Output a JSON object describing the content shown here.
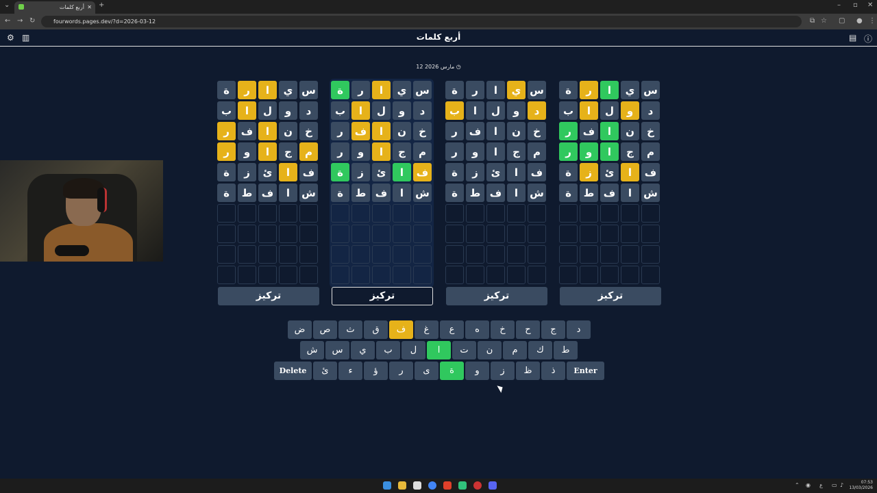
{
  "browser": {
    "tab_title": "أربع كلمات",
    "url": "fourwords.pages.dev/?d=2026-03-12"
  },
  "app": {
    "title": "أربع كلمات",
    "date": "12 مارس 2026"
  },
  "boards": [
    {
      "focus_label": "تركيز",
      "focused": false,
      "rows": [
        [
          [
            "س",
            "n"
          ],
          [
            "ي",
            "n"
          ],
          [
            "ا",
            "g"
          ],
          [
            "ر",
            "y"
          ],
          [
            "ة",
            "n"
          ]
        ],
        [
          [
            "د",
            "n"
          ],
          [
            "و",
            "y"
          ],
          [
            "ل",
            "n"
          ],
          [
            "ا",
            "y"
          ],
          [
            "ب",
            "n"
          ]
        ],
        [
          [
            "خ",
            "n"
          ],
          [
            "ن",
            "n"
          ],
          [
            "ا",
            "g"
          ],
          [
            "ف",
            "n"
          ],
          [
            "ر",
            "g"
          ]
        ],
        [
          [
            "م",
            "n"
          ],
          [
            "ج",
            "n"
          ],
          [
            "ا",
            "g"
          ],
          [
            "و",
            "g"
          ],
          [
            "ر",
            "g"
          ]
        ],
        [
          [
            "ف",
            "n"
          ],
          [
            "ا",
            "y"
          ],
          [
            "ئ",
            "n"
          ],
          [
            "ز",
            "y"
          ],
          [
            "ة",
            "n"
          ]
        ],
        [
          [
            "ش",
            "n"
          ],
          [
            "ا",
            "n"
          ],
          [
            "ف",
            "n"
          ],
          [
            "ط",
            "n"
          ],
          [
            "ة",
            "n"
          ]
        ]
      ]
    },
    {
      "focus_label": "تركيز",
      "focused": false,
      "rows": [
        [
          [
            "س",
            "n"
          ],
          [
            "ي",
            "y"
          ],
          [
            "ا",
            "n"
          ],
          [
            "ر",
            "n"
          ],
          [
            "ة",
            "n"
          ]
        ],
        [
          [
            "د",
            "y"
          ],
          [
            "و",
            "n"
          ],
          [
            "ل",
            "n"
          ],
          [
            "ا",
            "n"
          ],
          [
            "ب",
            "y"
          ]
        ],
        [
          [
            "خ",
            "n"
          ],
          [
            "ن",
            "n"
          ],
          [
            "ا",
            "n"
          ],
          [
            "ف",
            "n"
          ],
          [
            "ر",
            "n"
          ]
        ],
        [
          [
            "م",
            "n"
          ],
          [
            "ج",
            "n"
          ],
          [
            "ا",
            "n"
          ],
          [
            "و",
            "n"
          ],
          [
            "ر",
            "n"
          ]
        ],
        [
          [
            "ف",
            "n"
          ],
          [
            "ا",
            "n"
          ],
          [
            "ئ",
            "n"
          ],
          [
            "ز",
            "n"
          ],
          [
            "ة",
            "n"
          ]
        ],
        [
          [
            "ش",
            "n"
          ],
          [
            "ا",
            "n"
          ],
          [
            "ف",
            "n"
          ],
          [
            "ط",
            "n"
          ],
          [
            "ة",
            "n"
          ]
        ]
      ]
    },
    {
      "focus_label": "تركيز",
      "focused": true,
      "rows": [
        [
          [
            "س",
            "n"
          ],
          [
            "ي",
            "n"
          ],
          [
            "ا",
            "y"
          ],
          [
            "ر",
            "n"
          ],
          [
            "ة",
            "g"
          ]
        ],
        [
          [
            "د",
            "n"
          ],
          [
            "و",
            "n"
          ],
          [
            "ل",
            "n"
          ],
          [
            "ا",
            "y"
          ],
          [
            "ب",
            "n"
          ]
        ],
        [
          [
            "خ",
            "n"
          ],
          [
            "ن",
            "n"
          ],
          [
            "ا",
            "y"
          ],
          [
            "ف",
            "y"
          ],
          [
            "ر",
            "n"
          ]
        ],
        [
          [
            "م",
            "n"
          ],
          [
            "ج",
            "n"
          ],
          [
            "ا",
            "y"
          ],
          [
            "و",
            "n"
          ],
          [
            "ر",
            "n"
          ]
        ],
        [
          [
            "ف",
            "y"
          ],
          [
            "ا",
            "g"
          ],
          [
            "ئ",
            "n"
          ],
          [
            "ز",
            "n"
          ],
          [
            "ة",
            "g"
          ]
        ],
        [
          [
            "ش",
            "n"
          ],
          [
            "ا",
            "n"
          ],
          [
            "ف",
            "n"
          ],
          [
            "ط",
            "n"
          ],
          [
            "ة",
            "n"
          ]
        ]
      ]
    },
    {
      "focus_label": "تركيز",
      "focused": false,
      "rows": [
        [
          [
            "س",
            "n"
          ],
          [
            "ي",
            "n"
          ],
          [
            "ا",
            "y"
          ],
          [
            "ر",
            "y"
          ],
          [
            "ة",
            "n"
          ]
        ],
        [
          [
            "د",
            "n"
          ],
          [
            "و",
            "n"
          ],
          [
            "ل",
            "n"
          ],
          [
            "ا",
            "y"
          ],
          [
            "ب",
            "n"
          ]
        ],
        [
          [
            "خ",
            "n"
          ],
          [
            "ن",
            "n"
          ],
          [
            "ا",
            "y"
          ],
          [
            "ف",
            "n"
          ],
          [
            "ر",
            "y"
          ]
        ],
        [
          [
            "م",
            "y"
          ],
          [
            "ج",
            "n"
          ],
          [
            "ا",
            "y"
          ],
          [
            "و",
            "n"
          ],
          [
            "ر",
            "y"
          ]
        ],
        [
          [
            "ف",
            "n"
          ],
          [
            "ا",
            "y"
          ],
          [
            "ئ",
            "n"
          ],
          [
            "ز",
            "n"
          ],
          [
            "ة",
            "n"
          ]
        ],
        [
          [
            "ش",
            "n"
          ],
          [
            "ا",
            "n"
          ],
          [
            "ف",
            "n"
          ],
          [
            "ط",
            "n"
          ],
          [
            "ة",
            "n"
          ]
        ]
      ]
    }
  ],
  "keyboard": {
    "row1": [
      [
        "د",
        "n"
      ],
      [
        "ج",
        "n"
      ],
      [
        "ح",
        "n"
      ],
      [
        "خ",
        "n"
      ],
      [
        "ه",
        "n"
      ],
      [
        "ع",
        "n"
      ],
      [
        "غ",
        "n"
      ],
      [
        "ف",
        "y"
      ],
      [
        "ق",
        "n"
      ],
      [
        "ث",
        "n"
      ],
      [
        "ص",
        "n"
      ],
      [
        "ض",
        "n"
      ]
    ],
    "row2": [
      [
        "ط",
        "n"
      ],
      [
        "ك",
        "n"
      ],
      [
        "م",
        "n"
      ],
      [
        "ن",
        "n"
      ],
      [
        "ت",
        "n"
      ],
      [
        "ا",
        "g"
      ],
      [
        "ل",
        "n"
      ],
      [
        "ب",
        "n"
      ],
      [
        "ي",
        "n"
      ],
      [
        "س",
        "n"
      ],
      [
        "ش",
        "n"
      ]
    ],
    "row3": [
      [
        "Enter",
        "n"
      ],
      [
        "ذ",
        "n"
      ],
      [
        "ظ",
        "n"
      ],
      [
        "ز",
        "n"
      ],
      [
        "و",
        "n"
      ],
      [
        "ة",
        "g"
      ],
      [
        "ى",
        "n"
      ],
      [
        "ر",
        "n"
      ],
      [
        "ؤ",
        "n"
      ],
      [
        "ء",
        "n"
      ],
      [
        "ئ",
        "n"
      ],
      [
        "Delete",
        "n"
      ]
    ]
  },
  "taskbar": {
    "time": "07:53",
    "date": "13/03/2026"
  }
}
